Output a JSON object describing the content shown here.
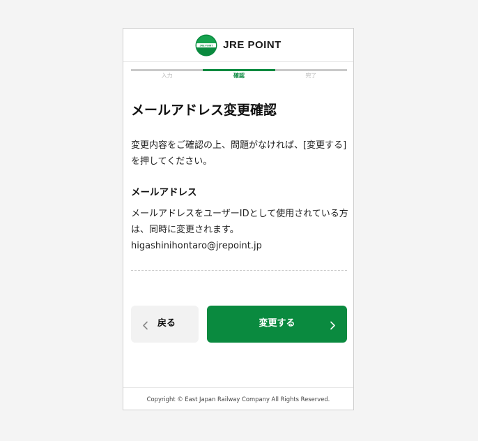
{
  "brand": {
    "logo_text": "JRE POINT",
    "logo_badge_text": "JRE POINT",
    "accent_color": "#0a8a3f"
  },
  "steps": [
    {
      "label": "入力",
      "active": false
    },
    {
      "label": "確認",
      "active": true
    },
    {
      "label": "完了",
      "active": false
    }
  ],
  "page": {
    "title": "メールアドレス変更確認",
    "description": "変更内容をご確認の上、問題がなければ、[変更する]を押してください。"
  },
  "email_section": {
    "heading": "メールアドレス",
    "note": "メールアドレスをユーザーIDとして使用されている方は、同時に変更されます。",
    "value": "higashinihontaro@jrepoint.jp"
  },
  "buttons": {
    "back_label": "戻る",
    "back_icon": "chevron-left-icon",
    "submit_label": "変更する",
    "submit_icon": "chevron-right-icon"
  },
  "footer": {
    "copyright": "Copyright © East Japan Railway Company All Rights Reserved."
  }
}
